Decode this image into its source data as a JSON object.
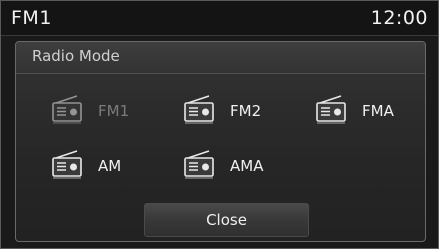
{
  "status_bar": {
    "title": "FM1",
    "clock": "12:00"
  },
  "popup": {
    "title": "Radio Mode",
    "modes": [
      {
        "label": "FM1",
        "icon": "radio-icon",
        "state": "current-disabled"
      },
      {
        "label": "FM2",
        "icon": "radio-icon",
        "state": "enabled"
      },
      {
        "label": "FMA",
        "icon": "radio-icon",
        "state": "enabled"
      },
      {
        "label": "AM",
        "icon": "radio-icon",
        "state": "enabled"
      },
      {
        "label": "AMA",
        "icon": "radio-icon",
        "state": "enabled"
      }
    ],
    "close_label": "Close"
  },
  "colors": {
    "background": "#1a1a1a",
    "text": "#f0f0f0",
    "disabled_text": "#7b7b7b"
  }
}
